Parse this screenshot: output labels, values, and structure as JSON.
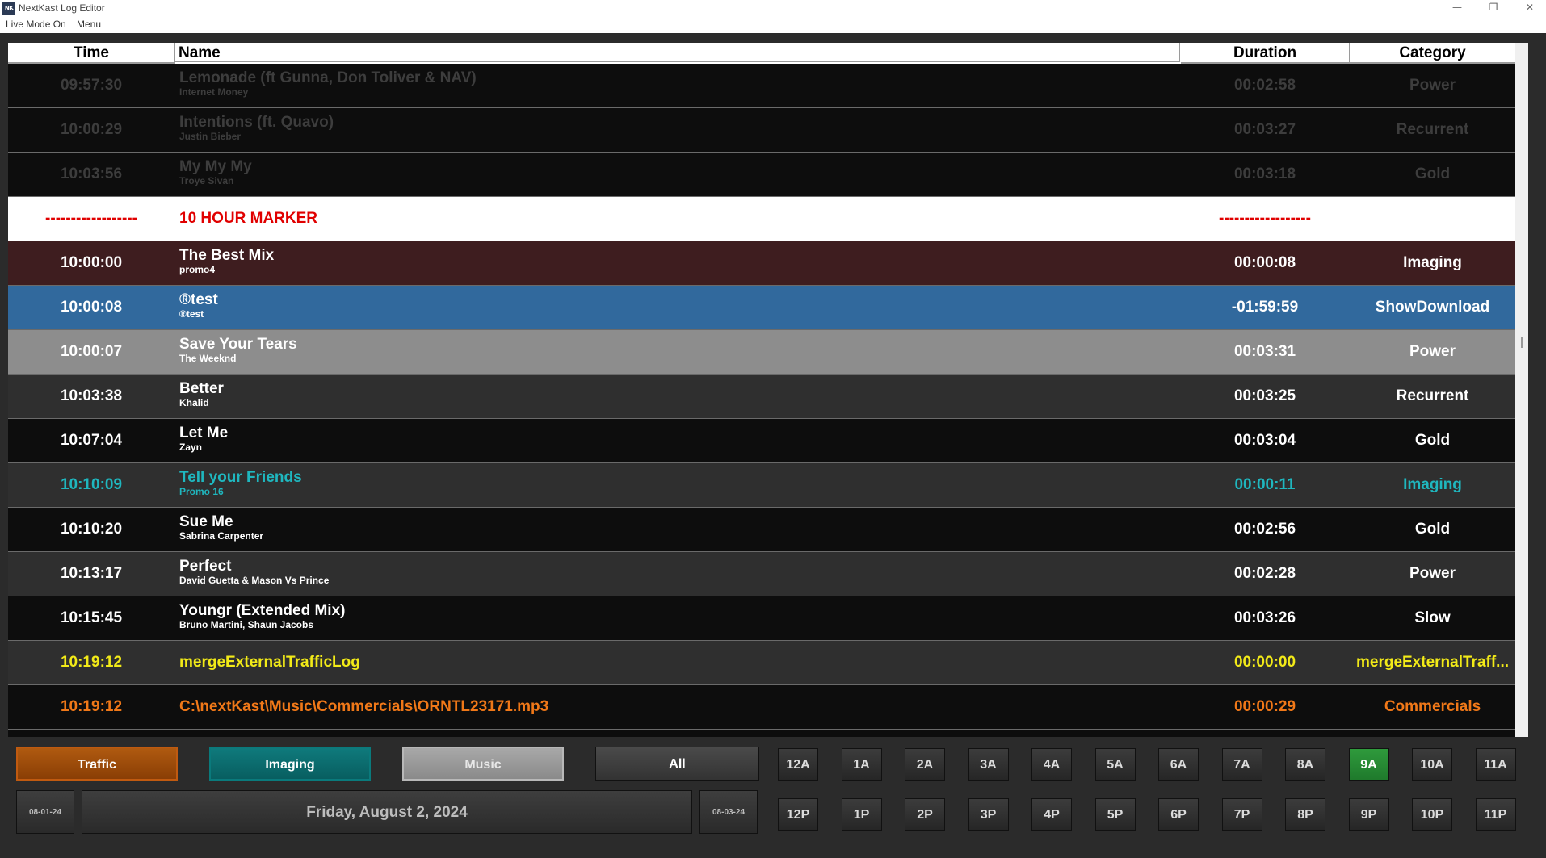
{
  "window": {
    "app_icon_text": "NK",
    "title": "NextKast Log Editor",
    "minimize_glyph": "—",
    "restore_glyph": "❐",
    "close_glyph": "✕"
  },
  "menubar": {
    "live_mode": "Live Mode On",
    "menu": "Menu"
  },
  "columns": {
    "time": "Time",
    "name": "Name",
    "duration": "Duration",
    "category": "Category"
  },
  "rows": [
    {
      "time": "09:57:30",
      "title": "Lemonade (ft Gunna, Don Toliver & NAV)",
      "subtitle": "Internet Money",
      "duration": "00:02:58",
      "category": "Power",
      "theme": "past"
    },
    {
      "time": "10:00:29",
      "title": "Intentions (ft. Quavo)",
      "subtitle": "Justin Bieber",
      "duration": "00:03:27",
      "category": "Recurrent",
      "theme": "past"
    },
    {
      "time": "10:03:56",
      "title": "My My My",
      "subtitle": "Troye Sivan",
      "duration": "00:03:18",
      "category": "Gold",
      "theme": "past"
    },
    {
      "time": "------------------",
      "title": "10 HOUR MARKER",
      "subtitle": "",
      "duration": "------------------",
      "category": "",
      "theme": "marker"
    },
    {
      "time": "10:00:00",
      "title": "The Best Mix",
      "subtitle": "promo4",
      "duration": "00:00:08",
      "category": "Imaging",
      "theme": "imaging"
    },
    {
      "time": "10:00:08",
      "title": "®test",
      "subtitle": "®test",
      "duration": "-01:59:59",
      "category": "ShowDownload",
      "theme": "selected"
    },
    {
      "time": "10:00:07",
      "title": "Save Your Tears",
      "subtitle": "The Weeknd",
      "duration": "00:03:31",
      "category": "Power",
      "theme": "gray"
    },
    {
      "time": "10:03:38",
      "title": "Better",
      "subtitle": "Khalid",
      "duration": "00:03:25",
      "category": "Recurrent",
      "theme": "dark"
    },
    {
      "time": "10:07:04",
      "title": "Let Me",
      "subtitle": "Zayn",
      "duration": "00:03:04",
      "category": "Gold",
      "theme": "black"
    },
    {
      "time": "10:10:09",
      "title": "Tell your Friends",
      "subtitle": "Promo 16",
      "duration": "00:00:11",
      "category": "Imaging",
      "theme": "cyan"
    },
    {
      "time": "10:10:20",
      "title": "Sue Me",
      "subtitle": "Sabrina Carpenter",
      "duration": "00:02:56",
      "category": "Gold",
      "theme": "black"
    },
    {
      "time": "10:13:17",
      "title": "Perfect",
      "subtitle": "David Guetta & Mason Vs Prince",
      "duration": "00:02:28",
      "category": "Power",
      "theme": "dark"
    },
    {
      "time": "10:15:45",
      "title": "Youngr (Extended Mix)",
      "subtitle": "Bruno Martini, Shaun Jacobs",
      "duration": "00:03:26",
      "category": "Slow",
      "theme": "black"
    },
    {
      "time": "10:19:12",
      "title": "mergeExternalTrafficLog",
      "subtitle": "",
      "duration": "00:00:00",
      "category": "mergeExternalTraff...",
      "theme": "yellow"
    },
    {
      "time": "10:19:12",
      "title": "C:\\nextKast\\Music\\Commercials\\ORNTL23171.mp3",
      "subtitle": "",
      "duration": "00:00:29",
      "category": "Commercials",
      "theme": "orange"
    }
  ],
  "filters": {
    "traffic": "Traffic",
    "imaging": "Imaging",
    "music": "Music",
    "all": "All"
  },
  "date_nav": {
    "prev": "08-01-24",
    "current": "Friday, August 2, 2024",
    "next": "08-03-24"
  },
  "hours_am": [
    "12A",
    "1A",
    "2A",
    "3A",
    "4A",
    "5A",
    "6A",
    "7A",
    "8A",
    "9A",
    "10A",
    "11A"
  ],
  "hours_pm": [
    "12P",
    "1P",
    "2P",
    "3P",
    "4P",
    "5P",
    "6P",
    "7P",
    "8P",
    "9P",
    "10P",
    "11P"
  ],
  "active_hour": "9A",
  "colors": {
    "selected_row": "#31699d",
    "marker_text": "#e00000",
    "imaging_row": "#3e1d1f",
    "cyan_text": "#1fb7bf",
    "yellow_text": "#f2ea18",
    "orange_text": "#f07818",
    "active_hour": "#2f9a3c"
  }
}
